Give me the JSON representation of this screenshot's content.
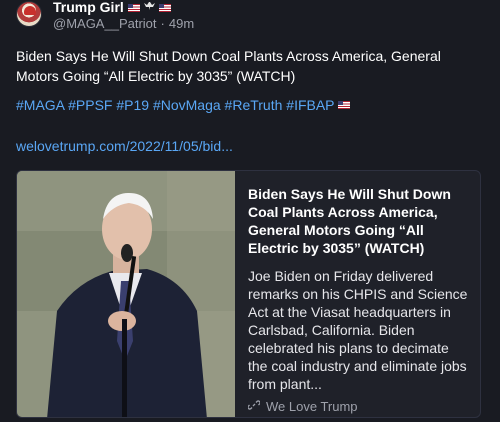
{
  "author": {
    "display_name": "Trump Girl",
    "handle": "@MAGA__Patriot",
    "separator": "·",
    "time": "49m"
  },
  "post": {
    "text": "Biden Says He Will Shut Down Coal Plants Across America, General Motors Going “All Electric by 3035” (WATCH)",
    "hashtags": "#MAGA #PPSF #P19 #NovMaga #ReTruth #IFBAP",
    "link": "welovetrump.com/2022/11/05/bid..."
  },
  "card": {
    "title": "Biden Says He Will Shut Down Coal Plants Across America, General Motors Going “All Electric by 3035” (WATCH)",
    "description": "Joe Biden on Friday delivered remarks on his CHPIS and Science Act at the Viasat headquarters in Carlsbad, California. Biden celebrated his plans to decimate the coal industry and eliminate jobs from plant...",
    "source": "We Love Trump",
    "image_alt_icon": "speaker-photo"
  },
  "icons": {
    "flag": "us-flag-icon",
    "eagle": "eagle-icon",
    "link": "link-icon"
  },
  "colors": {
    "background": "#191b22",
    "link": "#5aa7f5",
    "muted": "#9ea1ab"
  }
}
